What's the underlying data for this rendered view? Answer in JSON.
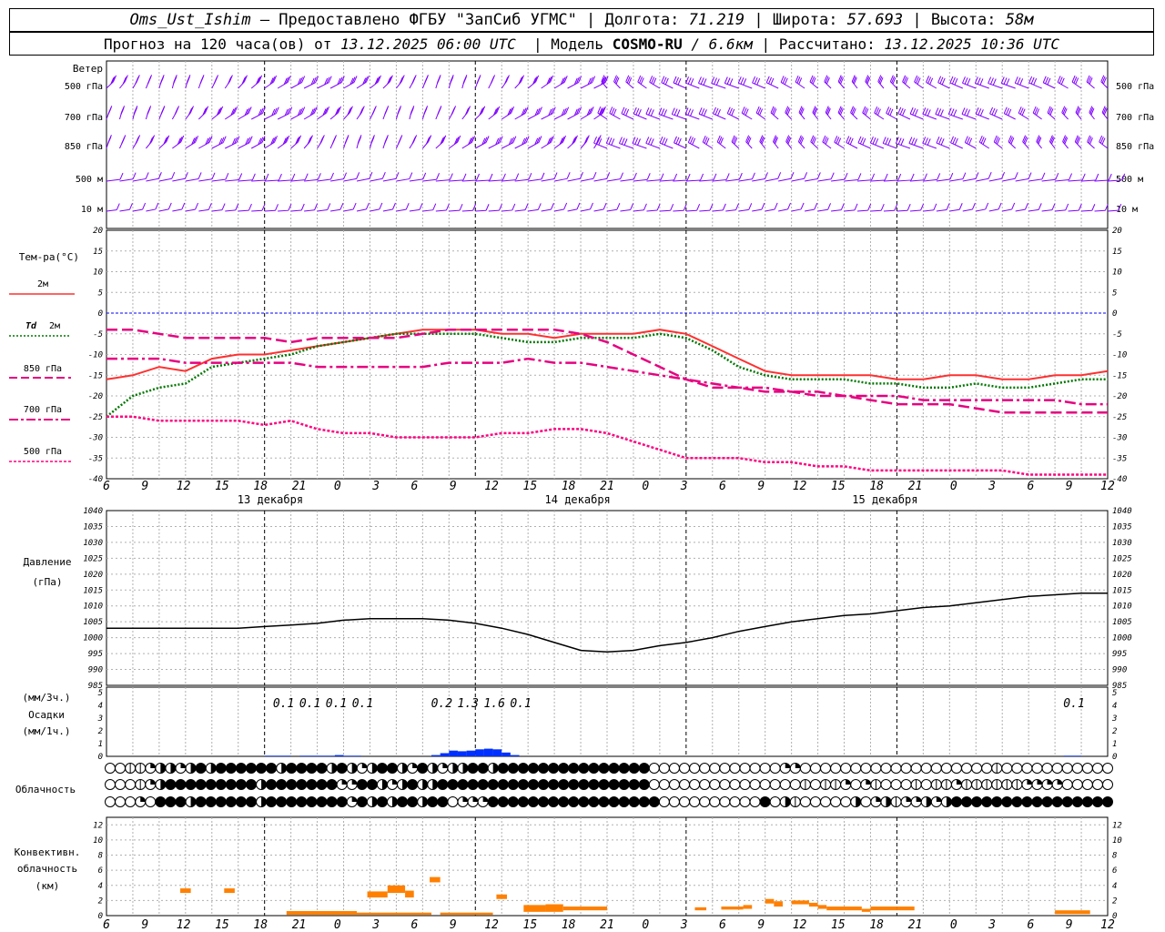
{
  "header": {
    "station": "Oms_Ust_Ishim",
    "provided_by": "– Предоставлено ФГБУ \"ЗапСиб УГМС\"",
    "lon_label": "Долгота:",
    "lon_value": "71.219",
    "lat_label": "Широта:",
    "lat_value": "57.693",
    "alt_label": "Высота:",
    "alt_value": "58м",
    "forecast_prefix": "Прогноз на 120 часа(ов) от",
    "forecast_time": "13.12.2025 06:00 UTC",
    "model_label": "Модель",
    "model_name": "COSMO-RU",
    "model_res": "/ 6.6км",
    "calc_label": "Рассчитано:",
    "calc_time": "13.12.2025 10:36 UTC"
  },
  "colors": {
    "wind": "#7f00ff",
    "t2m": "#ff3030",
    "td2m": "#007700",
    "t850": "#e60080",
    "t700": "#e60080",
    "t500": "#ff0080",
    "zero_line": "#0000ff",
    "pressure": "#000000",
    "precip": "#0030ff",
    "convective": "#ff8000",
    "grid": "#b0b0b0"
  },
  "time_axis": {
    "tick_labels": [
      "6",
      "9",
      "12",
      "15",
      "18",
      "21",
      "0",
      "3",
      "6",
      "9",
      "12",
      "15",
      "18",
      "21",
      "0",
      "3",
      "6",
      "9",
      "12",
      "15",
      "18",
      "21",
      "0",
      "3",
      "6",
      "9",
      "12"
    ],
    "day_labels": [
      "13 декабря",
      "14 декабря",
      "15 декабря"
    ]
  },
  "labels": {
    "wind": "Ветер",
    "wind_levels": [
      "500 гПа",
      "700 гПа",
      "850 гПа",
      "500 м",
      "10 м"
    ],
    "temp_title": "Тем-ра(°С)",
    "legend_t2m": "2м",
    "legend_td_sym": "Td",
    "legend_td": "2м",
    "legend_850": "850 гПа",
    "legend_700": "700 гПа",
    "legend_500": "500 гПа",
    "pressure_1": "Давление",
    "pressure_2": "(гПа)",
    "precip_1": "(мм/3ч.)",
    "precip_2": "Осадки",
    "precip_3": "(мм/1ч.)",
    "clouds": "Облачность",
    "conv_1": "Конвективн.",
    "conv_2": "облачность",
    "conv_3": "(км)"
  },
  "chart_data": [
    {
      "type": "line",
      "name": "wind_barbs_panel",
      "levels": [
        "500 гПа",
        "700 гПа",
        "850 гПа",
        "500 м",
        "10 м"
      ]
    },
    {
      "type": "line",
      "name": "temperature",
      "ylim": [
        -40,
        20
      ],
      "yticks": [
        20,
        15,
        10,
        5,
        0,
        -5,
        -10,
        -15,
        -20,
        -25,
        -30,
        -35,
        -40
      ],
      "x_hours": [
        0,
        3,
        6,
        9,
        12,
        15,
        18,
        21,
        24,
        27,
        30,
        33,
        36,
        39,
        42,
        45,
        48,
        51,
        54,
        57,
        60,
        63,
        66,
        69,
        72,
        75,
        78,
        81,
        84,
        87,
        90,
        93,
        96,
        99,
        102,
        105,
        108,
        111,
        114
      ],
      "series": [
        {
          "name": "2м",
          "values": [
            -16,
            -15,
            -13,
            -14,
            -11,
            -10,
            -10,
            -9,
            -8,
            -7,
            -6,
            -5,
            -4,
            -4,
            -4,
            -5,
            -5,
            -6,
            -5,
            -5,
            -5,
            -4,
            -5,
            -8,
            -11,
            -14,
            -15,
            -15,
            -15,
            -15,
            -16,
            -16,
            -15,
            -15,
            -16,
            -16,
            -15,
            -15,
            -14
          ]
        },
        {
          "name": "Td 2м",
          "values": [
            -25,
            -20,
            -18,
            -17,
            -13,
            -12,
            -11,
            -10,
            -8,
            -7,
            -6,
            -5,
            -5,
            -5,
            -5,
            -6,
            -7,
            -7,
            -6,
            -6,
            -6,
            -5,
            -6,
            -9,
            -13,
            -15,
            -16,
            -16,
            -16,
            -17,
            -17,
            -18,
            -18,
            -17,
            -18,
            -18,
            -17,
            -16,
            -16
          ]
        },
        {
          "name": "850 гПа",
          "values": [
            -4,
            -4,
            -5,
            -6,
            -6,
            -6,
            -6,
            -7,
            -6,
            -6,
            -6,
            -6,
            -5,
            -4,
            -4,
            -4,
            -4,
            -4,
            -5,
            -7,
            -10,
            -13,
            -16,
            -18,
            -18,
            -19,
            -19,
            -20,
            -20,
            -21,
            -22,
            -22,
            -22,
            -23,
            -24,
            -24,
            -24,
            -24,
            -24
          ]
        },
        {
          "name": "700 гПа",
          "values": [
            -11,
            -11,
            -11,
            -12,
            -12,
            -12,
            -12,
            -12,
            -13,
            -13,
            -13,
            -13,
            -13,
            -12,
            -12,
            -12,
            -11,
            -12,
            -12,
            -13,
            -14,
            -15,
            -16,
            -17,
            -18,
            -18,
            -19,
            -19,
            -20,
            -20,
            -20,
            -21,
            -21,
            -21,
            -21,
            -21,
            -21,
            -22,
            -22
          ]
        },
        {
          "name": "500 гПа",
          "values": [
            -25,
            -25,
            -26,
            -26,
            -26,
            -26,
            -27,
            -26,
            -28,
            -29,
            -29,
            -30,
            -30,
            -30,
            -30,
            -29,
            -29,
            -28,
            -28,
            -29,
            -31,
            -33,
            -35,
            -35,
            -35,
            -36,
            -36,
            -37,
            -37,
            -38,
            -38,
            -38,
            -38,
            -38,
            -38,
            -39,
            -39,
            -39,
            -39
          ]
        }
      ]
    },
    {
      "type": "line",
      "name": "pressure",
      "ylim": [
        985,
        1040
      ],
      "yticks": [
        1040,
        1035,
        1030,
        1025,
        1020,
        1015,
        1010,
        1005,
        1000,
        995,
        990,
        985
      ],
      "x_hours": [
        0,
        3,
        6,
        9,
        12,
        15,
        18,
        21,
        24,
        27,
        30,
        33,
        36,
        39,
        42,
        45,
        48,
        51,
        54,
        57,
        60,
        63,
        66,
        69,
        72,
        75,
        78,
        81,
        84,
        87,
        90,
        93,
        96,
        99,
        102,
        105,
        108,
        111,
        114
      ],
      "values": [
        1003,
        1003,
        1003,
        1003,
        1003,
        1003,
        1003.5,
        1004,
        1004.5,
        1005.5,
        1006,
        1006,
        1006,
        1005.5,
        1004.5,
        1003,
        1001,
        998.5,
        996,
        995.5,
        996,
        997.5,
        998.5,
        1000,
        1002,
        1003.5,
        1005,
        1006,
        1007,
        1007.5,
        1008.5,
        1009.5,
        1010,
        1011,
        1012,
        1013,
        1013.5,
        1014,
        1014
      ]
    },
    {
      "type": "bar",
      "name": "precipitation",
      "ylim": [
        0,
        5
      ],
      "yticks": [
        5,
        4,
        3,
        2,
        1,
        0
      ],
      "labels_3h": [
        {
          "hour": 21,
          "text": "0.1"
        },
        {
          "hour": 24,
          "text": "0.1"
        },
        {
          "hour": 27,
          "text": "0.1"
        },
        {
          "hour": 30,
          "text": "0.1"
        },
        {
          "hour": 39,
          "text": "0.2"
        },
        {
          "hour": 42,
          "text": "1.3"
        },
        {
          "hour": 45,
          "text": "1.6"
        },
        {
          "hour": 48,
          "text": "0.1"
        },
        {
          "hour": 111,
          "text": "0.1"
        }
      ],
      "bars_1h": [
        {
          "hour": 19,
          "value": 0.05
        },
        {
          "hour": 20,
          "value": 0.05
        },
        {
          "hour": 21,
          "value": 0.05
        },
        {
          "hour": 23,
          "value": 0.05
        },
        {
          "hour": 24,
          "value": 0.05
        },
        {
          "hour": 25,
          "value": 0.05
        },
        {
          "hour": 26,
          "value": 0.05
        },
        {
          "hour": 27,
          "value": 0.1
        },
        {
          "hour": 28,
          "value": 0.05
        },
        {
          "hour": 29,
          "value": 0.05
        },
        {
          "hour": 38,
          "value": 0.1
        },
        {
          "hour": 39,
          "value": 0.25
        },
        {
          "hour": 40,
          "value": 0.45
        },
        {
          "hour": 41,
          "value": 0.4
        },
        {
          "hour": 42,
          "value": 0.45
        },
        {
          "hour": 43,
          "value": 0.55
        },
        {
          "hour": 44,
          "value": 0.6
        },
        {
          "hour": 45,
          "value": 0.55
        },
        {
          "hour": 46,
          "value": 0.3
        },
        {
          "hour": 47,
          "value": 0.1
        },
        {
          "hour": 110,
          "value": 0.05
        },
        {
          "hour": 111,
          "value": 0.05
        }
      ]
    },
    {
      "type": "table",
      "name": "cloudiness",
      "rows": [
        "0011233234344444434444343234432432334434444444444444440000000000000220000000000000000000100000000000",
        "0001234444444443444444422443234334444444444444444444440000000000000001011202100010112111111222200000",
        "0002044434444443444444442434344344022244444444444444444000000000040310000030231223234444444444444444"
      ]
    },
    {
      "type": "bar",
      "name": "convective_cloudiness",
      "ylim": [
        0,
        13
      ],
      "yticks": [
        12,
        10,
        8,
        6,
        4,
        2,
        0
      ],
      "segments": [
        {
          "h0": 8.4,
          "h1": 9.6,
          "top": 3.6,
          "bot": 3.0
        },
        {
          "h0": 13.4,
          "h1": 14.6,
          "top": 3.6,
          "bot": 3.0
        },
        {
          "h0": 20.5,
          "h1": 28.5,
          "top": 0.6,
          "bot": 0.1
        },
        {
          "h0": 28.5,
          "h1": 37,
          "top": 0.4,
          "bot": 0.1
        },
        {
          "h0": 29.7,
          "h1": 32,
          "top": 3.2,
          "bot": 2.4
        },
        {
          "h0": 32,
          "h1": 34,
          "top": 4.0,
          "bot": 3.0
        },
        {
          "h0": 34,
          "h1": 35,
          "top": 3.3,
          "bot": 2.4
        },
        {
          "h0": 36.8,
          "h1": 38,
          "top": 5.1,
          "bot": 4.4
        },
        {
          "h0": 38,
          "h1": 44,
          "top": 0.4,
          "bot": 0.1
        },
        {
          "h0": 44.4,
          "h1": 45.6,
          "top": 2.8,
          "bot": 2.2
        },
        {
          "h0": 47.5,
          "h1": 50,
          "top": 1.4,
          "bot": 0.5
        },
        {
          "h0": 50,
          "h1": 52,
          "top": 1.5,
          "bot": 0.5
        },
        {
          "h0": 52,
          "h1": 57,
          "top": 1.2,
          "bot": 0.7
        },
        {
          "h0": 67,
          "h1": 68.3,
          "top": 1.1,
          "bot": 0.7
        },
        {
          "h0": 70,
          "h1": 72.5,
          "top": 1.2,
          "bot": 0.8
        },
        {
          "h0": 72.5,
          "h1": 73.5,
          "top": 1.4,
          "bot": 0.9
        },
        {
          "h0": 75,
          "h1": 76,
          "top": 2.2,
          "bot": 1.6
        },
        {
          "h0": 76,
          "h1": 77,
          "top": 1.9,
          "bot": 1.2
        },
        {
          "h0": 78,
          "h1": 80,
          "top": 2.0,
          "bot": 1.5
        },
        {
          "h0": 80,
          "h1": 81,
          "top": 1.7,
          "bot": 1.2
        },
        {
          "h0": 81,
          "h1": 82,
          "top": 1.4,
          "bot": 0.9
        },
        {
          "h0": 82,
          "h1": 86,
          "top": 1.2,
          "bot": 0.7
        },
        {
          "h0": 86,
          "h1": 87,
          "top": 0.9,
          "bot": 0.5
        },
        {
          "h0": 87,
          "h1": 90,
          "top": 1.2,
          "bot": 0.7
        },
        {
          "h0": 90,
          "h1": 92,
          "top": 1.2,
          "bot": 0.7
        },
        {
          "h0": 108,
          "h1": 112,
          "top": 0.7,
          "bot": 0.2
        }
      ]
    }
  ]
}
